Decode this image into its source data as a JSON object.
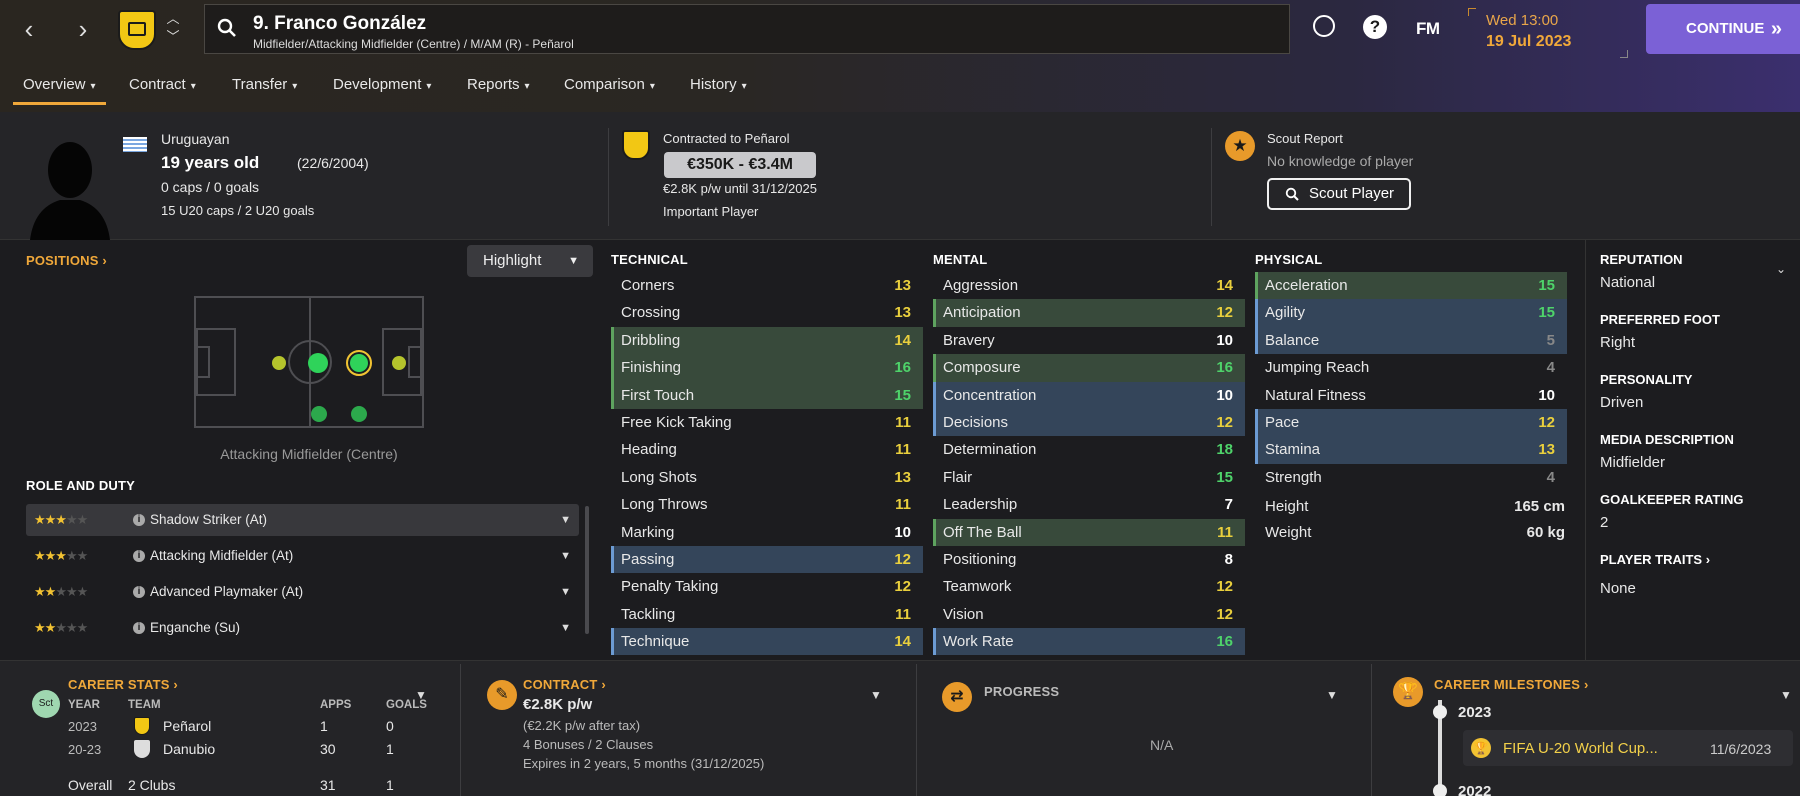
{
  "header": {
    "player_title": "9. Franco González",
    "player_subtitle": "Midfielder/Attacking Midfielder (Centre) / M/AM (R) - Peñarol",
    "fm_label": "FM",
    "day_time": "Wed 13:00",
    "date": "19 Jul 2023",
    "continue_label": "CONTINUE"
  },
  "tabs": [
    {
      "label": "Overview"
    },
    {
      "label": "Contract"
    },
    {
      "label": "Transfer"
    },
    {
      "label": "Development"
    },
    {
      "label": "Reports"
    },
    {
      "label": "Comparison"
    },
    {
      "label": "History"
    }
  ],
  "profile": {
    "nationality": "Uruguayan",
    "age": "19 years old",
    "dob": "(22/6/2004)",
    "caps": "0 caps / 0 goals",
    "u20_caps": "15 U20 caps / 2 U20 goals"
  },
  "contract_summary": {
    "title": "Contracted to Peñarol",
    "value": "€350K - €3.4M",
    "wage": "€2.8K p/w until 31/12/2025",
    "status": "Important Player"
  },
  "scout": {
    "title": "Scout Report",
    "knowledge": "No knowledge of player",
    "button": "Scout Player"
  },
  "positions": {
    "heading": "POSITIONS",
    "highlight": "Highlight",
    "label": "Attacking Midfielder (Centre)"
  },
  "roles": {
    "heading": "ROLE AND DUTY",
    "items": [
      {
        "label": "Shadow Striker (At)",
        "stars": 2.5
      },
      {
        "label": "Attacking Midfielder (At)",
        "stars": 2.5
      },
      {
        "label": "Advanced Playmaker (At)",
        "stars": 2
      },
      {
        "label": "Enganche (Su)",
        "stars": 2
      }
    ]
  },
  "attributes": {
    "technical": {
      "heading": "TECHNICAL",
      "items": [
        {
          "name": "Corners",
          "value": "13",
          "hl": ""
        },
        {
          "name": "Crossing",
          "value": "13",
          "hl": ""
        },
        {
          "name": "Dribbling",
          "value": "14",
          "hl": "g"
        },
        {
          "name": "Finishing",
          "value": "16",
          "hl": "g"
        },
        {
          "name": "First Touch",
          "value": "15",
          "hl": "g"
        },
        {
          "name": "Free Kick Taking",
          "value": "11",
          "hl": ""
        },
        {
          "name": "Heading",
          "value": "11",
          "hl": ""
        },
        {
          "name": "Long Shots",
          "value": "13",
          "hl": ""
        },
        {
          "name": "Long Throws",
          "value": "11",
          "hl": ""
        },
        {
          "name": "Marking",
          "value": "10",
          "hl": ""
        },
        {
          "name": "Passing",
          "value": "12",
          "hl": "b"
        },
        {
          "name": "Penalty Taking",
          "value": "12",
          "hl": ""
        },
        {
          "name": "Tackling",
          "value": "11",
          "hl": ""
        },
        {
          "name": "Technique",
          "value": "14",
          "hl": "b"
        }
      ]
    },
    "mental": {
      "heading": "MENTAL",
      "items": [
        {
          "name": "Aggression",
          "value": "14",
          "hl": ""
        },
        {
          "name": "Anticipation",
          "value": "12",
          "hl": "g"
        },
        {
          "name": "Bravery",
          "value": "10",
          "hl": ""
        },
        {
          "name": "Composure",
          "value": "16",
          "hl": "g"
        },
        {
          "name": "Concentration",
          "value": "10",
          "hl": "b"
        },
        {
          "name": "Decisions",
          "value": "12",
          "hl": "b"
        },
        {
          "name": "Determination",
          "value": "18",
          "hl": ""
        },
        {
          "name": "Flair",
          "value": "15",
          "hl": ""
        },
        {
          "name": "Leadership",
          "value": "7",
          "hl": ""
        },
        {
          "name": "Off The Ball",
          "value": "11",
          "hl": "g"
        },
        {
          "name": "Positioning",
          "value": "8",
          "hl": ""
        },
        {
          "name": "Teamwork",
          "value": "12",
          "hl": ""
        },
        {
          "name": "Vision",
          "value": "12",
          "hl": ""
        },
        {
          "name": "Work Rate",
          "value": "16",
          "hl": "b"
        }
      ]
    },
    "physical": {
      "heading": "PHYSICAL",
      "items": [
        {
          "name": "Acceleration",
          "value": "15",
          "hl": "g"
        },
        {
          "name": "Agility",
          "value": "15",
          "hl": "b"
        },
        {
          "name": "Balance",
          "value": "5",
          "hl": "b"
        },
        {
          "name": "Jumping Reach",
          "value": "4",
          "hl": ""
        },
        {
          "name": "Natural Fitness",
          "value": "10",
          "hl": ""
        },
        {
          "name": "Pace",
          "value": "12",
          "hl": "b"
        },
        {
          "name": "Stamina",
          "value": "13",
          "hl": "b"
        },
        {
          "name": "Strength",
          "value": "4",
          "hl": ""
        }
      ],
      "height_label": "Height",
      "height": "165 cm",
      "weight_label": "Weight",
      "weight": "60 kg"
    }
  },
  "details": {
    "reputation_h": "REPUTATION",
    "reputation": "National",
    "foot_h": "PREFERRED FOOT",
    "foot": "Right",
    "personality_h": "PERSONALITY",
    "personality": "Driven",
    "media_h": "MEDIA DESCRIPTION",
    "media": "Midfielder",
    "gk_h": "GOALKEEPER RATING",
    "gk": "2",
    "traits_h": "PLAYER TRAITS",
    "traits": "None"
  },
  "career_stats": {
    "heading": "CAREER STATS",
    "badge": "Sct",
    "cols": [
      "YEAR",
      "TEAM",
      "APPS",
      "GOALS"
    ],
    "rows": [
      {
        "year": "2023",
        "team": "Peñarol",
        "apps": "1",
        "goals": "0"
      },
      {
        "year": "20-23",
        "team": "Danubio",
        "apps": "30",
        "goals": "1"
      }
    ],
    "overall": {
      "label": "Overall",
      "team": "2 Clubs",
      "apps": "31",
      "goals": "1"
    }
  },
  "contract_panel": {
    "heading": "CONTRACT",
    "wage": "€2.8K p/w",
    "after_tax": "(€2.2K p/w after tax)",
    "bonuses": "4 Bonuses / 2 Clauses",
    "expires": "Expires in 2 years, 5 months (31/12/2025)"
  },
  "progress": {
    "heading": "PROGRESS",
    "value": "N/A"
  },
  "milestones": {
    "heading": "CAREER MILESTONES",
    "year1": "2023",
    "item1": "FIFA U-20 World Cup...",
    "item1_date": "11/6/2023",
    "year2": "2022"
  }
}
